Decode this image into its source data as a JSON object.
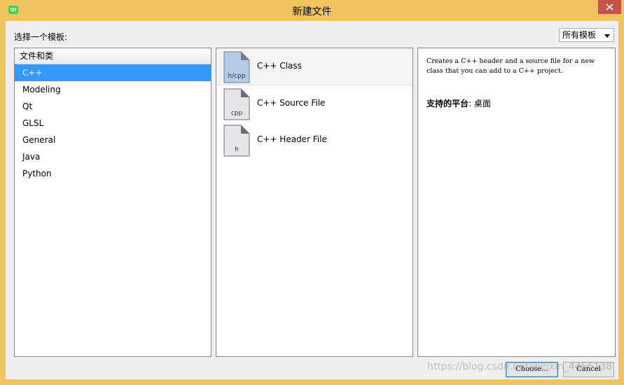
{
  "window": {
    "title": "新建文件",
    "app_icon_text": "Qt"
  },
  "choose_template_label": "选择一个模板:",
  "filter": {
    "selected": "所有模板"
  },
  "categories": {
    "header": "文件和类",
    "items": [
      "C++",
      "Modeling",
      "Qt",
      "GLSL",
      "General",
      "Java",
      "Python"
    ],
    "selected_index": 0
  },
  "templates": [
    {
      "label": "C++ Class",
      "icon_text": "h/cpp",
      "icon": "cpp-class-file-icon"
    },
    {
      "label": "C++ Source File",
      "icon_text": "cpp",
      "icon": "cpp-source-file-icon"
    },
    {
      "label": "C++ Header File",
      "icon_text": "h",
      "icon": "cpp-header-file-icon"
    }
  ],
  "description": {
    "text": "Creates a C++ header and a source file for a new class that you can add to a C++ project.",
    "platform_label": "支持的平台",
    "platform_value": ": 桌面"
  },
  "buttons": {
    "choose": "Choose...",
    "cancel": "Cancel"
  },
  "watermark": "https://blog.csdn.net/weixin_4456138",
  "colors": {
    "title_bar": "#f0c45c",
    "selection": "#3399ff",
    "close_button": "#c7504a"
  }
}
